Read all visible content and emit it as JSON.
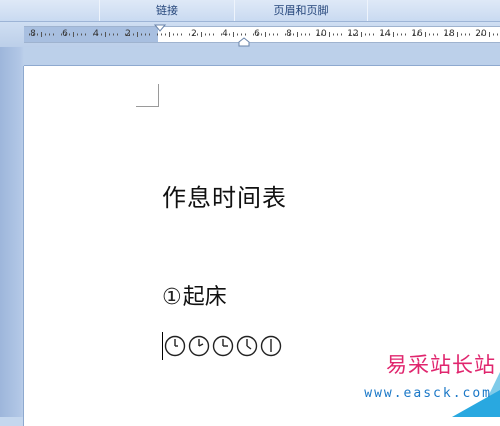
{
  "ribbon": {
    "groups": [
      {
        "label": "链接"
      },
      {
        "label": "页眉和页脚"
      },
      {
        "label": ""
      }
    ]
  },
  "ruler": {
    "numbers": [
      "8",
      "6",
      "4",
      "2",
      "2",
      "4",
      "6",
      "8",
      "10",
      "12",
      "14",
      "16",
      "18",
      "20"
    ]
  },
  "document": {
    "title": "作息时间表",
    "item_number": "①",
    "item_text": "起床",
    "clock_icons": [
      "clock-icon",
      "clock-icon",
      "clock-icon",
      "clock-icon",
      "clock-icon"
    ]
  },
  "watermark": {
    "name": "易采站长站",
    "url": "www.easck.com"
  },
  "colors": {
    "ribbon_text": "#24457a",
    "ruler_margin": "#a8bfe0",
    "workspace": "#bcd0ea",
    "watermark_name": "#e0266e",
    "watermark_url": "#1b78c7",
    "watermark_corner": "#29a8e0"
  }
}
